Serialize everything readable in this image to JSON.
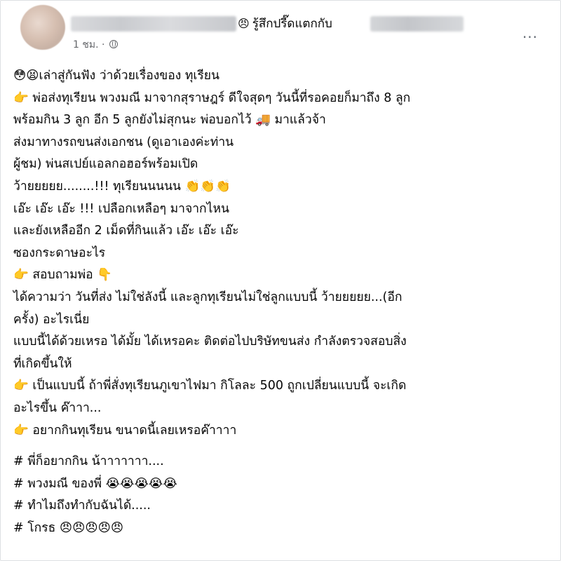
{
  "post": {
    "header": {
      "feeling_emoji": "😠",
      "feeling_text": "รู้สึกปรี๊ดแตกกับ",
      "time": "1 ชม.",
      "privacy_separator": "·",
      "more_icon_glyph": "···"
    },
    "body_lines": [
      "😳😫เล่าสู่กันฟัง ว่าด้วยเรื่องของ ทุเรียน",
      "👉 พ่อส่งทุเรียน พวงมณี มาจากสุราษฎร์ ดีใจสุดๆ วันนี้ที่รอคอยก็มาถึง 8 ลูก",
      "พร้อมกิน 3 ลูก อีก 5 ลูกยังไม่สุกนะ พ่อบอกไว้ 🚚 มาแล้วจ้า",
      "ส่งมาทางรถขนส่งเอกชน (ดูเอาเองค่ะท่าน",
      "ผู้ชม) พ่นสเปย์แอลกอฮอร์พร้อมเปิด",
      "ว้ายยยยย........!!! ทุเรียนนนนน 👏👏👏",
      "เอ๊ะ เอ๊ะ เอ๊ะ !!! เปลือกเหลือๆ มาจากไหน",
      "และยังเหลืออีก 2 เม็ดที่กินแล้ว เอ๊ะ เอ๊ะ เอ๊ะ",
      "ซองกระดาษอะไร",
      "👉 สอบถามพ่อ 👇",
      "ได้ความว่า วันที่ส่ง ไม่ใช่ลังนี้ และลูกทุเรียนไม่ใช่ลูกแบบนี้ ว้ายยยยย...(อีก",
      "ครั้ง) อะไรเนี่ย",
      "แบบนี้ได้ด้วยเหรอ ได้มั้ย ได้เหรอคะ  ติดต่อไปบริษัทขนส่ง กำลังตรวจสอบสิ่ง",
      "ที่เกิดขึ้นให้",
      "👉 เป็นแบบนี้ ถ้าพี่สั่งทุเรียนภูเขาไฟมา กิโลละ 500 ถูกเปลี่ยนแบบนี้ จะเกิด",
      "อะไรขึ้น ค๊าาา...",
      "👉 อยากกินทุเรียน ขนาดนี้เลยเหรอค๊าาาา"
    ],
    "hashtag_lines": [
      "# พี่ก็อยากกิน น้าาาาาาา....",
      "# พวงมณี ของพี่ 😭😭😭😭😭",
      "# ทำไมถึงทำกับฉันได้.....",
      "# โกรธ 😠😠😠😠😠"
    ]
  }
}
